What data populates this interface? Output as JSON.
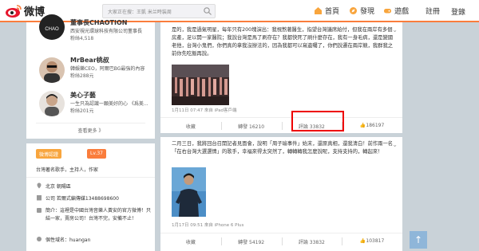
{
  "topbar": {
    "brand": "微博",
    "search_placeholder": "大家正在搜：王凱 米兰時装周",
    "nav": [
      {
        "icon": "home-icon",
        "label": "首頁"
      },
      {
        "icon": "discover-icon",
        "label": "發現"
      },
      {
        "icon": "game-icon",
        "label": "遊戲"
      },
      {
        "icon": "",
        "label": "註冊"
      }
    ],
    "login": "登錄"
  },
  "sidebar": {
    "people": [
      {
        "name": "董事長CHAOTION",
        "desc": "西安視光環球科技有限公司董事長",
        "fans": "粉絲4,518"
      },
      {
        "name": "MrBear桃叔",
        "desc": "韓娛樂CEO，阿爾巴BG最強的內容",
        "fans": "粉絲288元"
      },
      {
        "name": "美心子藝",
        "desc": "一生只為認識一顆美好的心 《爲美...",
        "fans": "粉絲201元"
      }
    ],
    "more": "查看更多 》"
  },
  "profile": {
    "verified_badge": "微博認證",
    "level_badge": "Lv.37",
    "intro": "台灣著名歌手，主持人，作家",
    "rows": [
      {
        "icon": "location-icon",
        "text": "北京 朝陽區"
      },
      {
        "icon": "company-icon",
        "text": "公司 若爾式編傳媒13488698600"
      },
      {
        "icon": "intro-icon",
        "text": "簡介：這裡是中國台灣音樂人黃安的官方微博！只結一家，賣房公司！台灣不完，安備不止！"
      },
      {
        "icon": "domain-icon",
        "text": "個性域名：huangan"
      }
    ]
  },
  "posts": [
    {
      "text": "是的，我是過氣明星，每年只有200塊演出：我視熬著醫生，指望台灣議席給付，但我在兩岸有多個房產，足以開一家醫院；我說台灣是馬了刷存在？我都快死了刷什麼存在，我有一身毛病，還是變國老他，台灣小鬼們，你們真的拿我沒辦法的，因為我都可以寫遺囑了，你們說遷在兩岸競，我群我之前你先吃飯再說。",
      "meta": "1月11日 07:47 來自 iPad客戶端",
      "actions": [
        "收藏",
        "轉發 16210",
        "評論 33832",
        "186197"
      ]
    },
    {
      "text": "二月三日，我將回台召開記者見面會，說明「周子瑜事件」始末，還原真相，還我清白！前作兩一名「在右台灣大選選情」的歌手，幸福來得太突然了，轉轉轉我怎麼說呢，支持支持的，轉起來！",
      "meta": "1月17日 09:51 來自 iPhone 6 Plus",
      "actions": [
        "收藏",
        "轉發 54192",
        "評論 33832",
        "103817"
      ]
    }
  ]
}
